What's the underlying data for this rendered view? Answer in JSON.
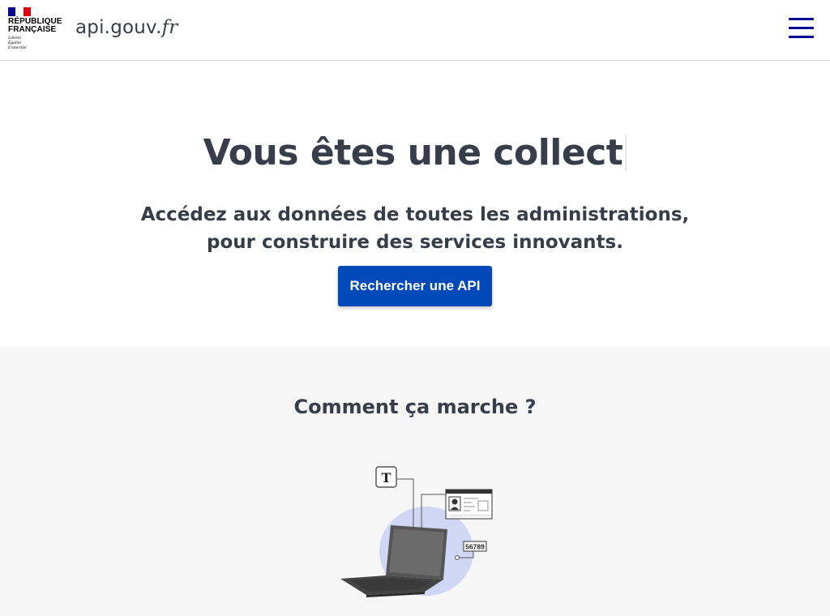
{
  "header": {
    "republique_line1": "RÉPUBLIQUE",
    "republique_line2": "FRANÇAISE",
    "devise": [
      "Liberté",
      "Égalité",
      "Fraternité"
    ],
    "site_name_main": "api.gouv.",
    "site_name_fr": "fr",
    "menu_icon": "hamburger-menu-icon"
  },
  "hero": {
    "title": "Vous êtes une collect",
    "subtitle_line1": "Accédez aux données de toutes les administrations,",
    "subtitle_line2": "pour construire des services innovants.",
    "cta_label": "Rechercher une API"
  },
  "how": {
    "title": "Comment ça marche ?",
    "illustration": {
      "text_badge": "T",
      "number_badge": "56789"
    }
  },
  "colors": {
    "primary_blue": "#000091",
    "button_blue": "#0249b9",
    "text_dark": "#383e49",
    "section_gray": "#f6f6f6",
    "illustration_circle": "#cfd7f5"
  }
}
